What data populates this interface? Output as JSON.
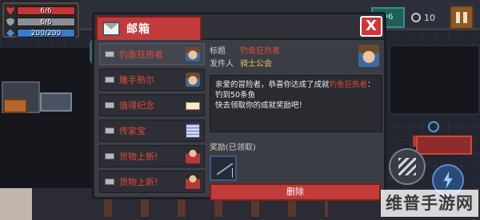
{
  "hud": {
    "health": {
      "text": "6/6",
      "fraction": 1.0
    },
    "armor": {
      "text": "6/6",
      "fraction": 1.0
    },
    "energy": {
      "text": "200/200",
      "fraction": 1.0
    },
    "gem_text": "96",
    "coin_text": "10"
  },
  "mailbox": {
    "title": "邮箱",
    "close_label": "X",
    "items": [
      {
        "label": "钓鱼狂热者",
        "thumb": "thumb-face",
        "icon": "angler-avatar-icon"
      },
      {
        "label": "雕手熟尔",
        "thumb": "thumb-face",
        "icon": "sculptor-avatar-icon"
      },
      {
        "label": "值得纪念",
        "thumb": "thumb-note",
        "icon": "note-icon"
      },
      {
        "label": "传家宝",
        "thumb": "thumb-calendar",
        "icon": "calendar-icon"
      },
      {
        "label": "货物上新!",
        "thumb": "thumb-merchant",
        "icon": "merchant-icon"
      },
      {
        "label": "货物上新!",
        "thumb": "thumb-merchant",
        "icon": "merchant-icon"
      }
    ],
    "selected_index": 0,
    "detail": {
      "subject_key": "标题",
      "subject_value": "钓鱼狂热者",
      "sender_key": "发件人",
      "sender_value": "骑士公会",
      "body_prefix": "亲爱的冒险者，恭喜你达成了成就",
      "body_highlight": "钓鱼狂热者",
      "body_colon": "：",
      "body_line2": "钓到50条鱼",
      "body_line3": "快去领取你的成就奖励吧！",
      "reward_label": "奖励(已领取)",
      "reward_icon": "fishing-rod-icon",
      "delete_label": "删除"
    }
  },
  "watermark": "维普手游网",
  "colors": {
    "accent_red": "#c23b3b",
    "highlight_red": "#e04a3a",
    "panel": "#3b3d45"
  }
}
